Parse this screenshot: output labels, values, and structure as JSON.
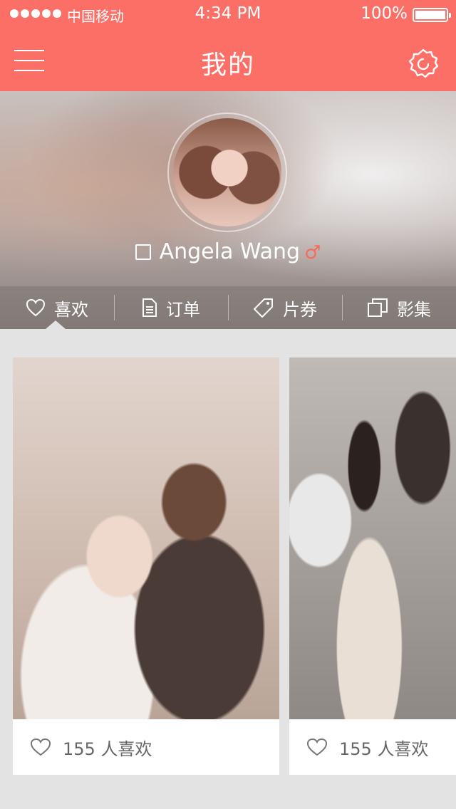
{
  "status_bar": {
    "carrier": "中国移动",
    "time": "4:34 PM",
    "battery": "100%"
  },
  "nav": {
    "title": "我的",
    "menu_icon": "hamburger-icon",
    "settings_icon": "gear-icon"
  },
  "profile": {
    "name": "Angela Wang",
    "gender_symbol": "♂"
  },
  "tabs": [
    {
      "label": "喜欢",
      "icon": "heart-icon"
    },
    {
      "label": "订单",
      "icon": "document-icon"
    },
    {
      "label": "片券",
      "icon": "tag-icon"
    },
    {
      "label": "影集",
      "icon": "album-icon"
    }
  ],
  "cards": [
    {
      "likes": "155 人喜欢"
    },
    {
      "likes": "155 人喜欢"
    }
  ],
  "colors": {
    "accent": "#fb6f67",
    "background": "#e3e3e3"
  }
}
